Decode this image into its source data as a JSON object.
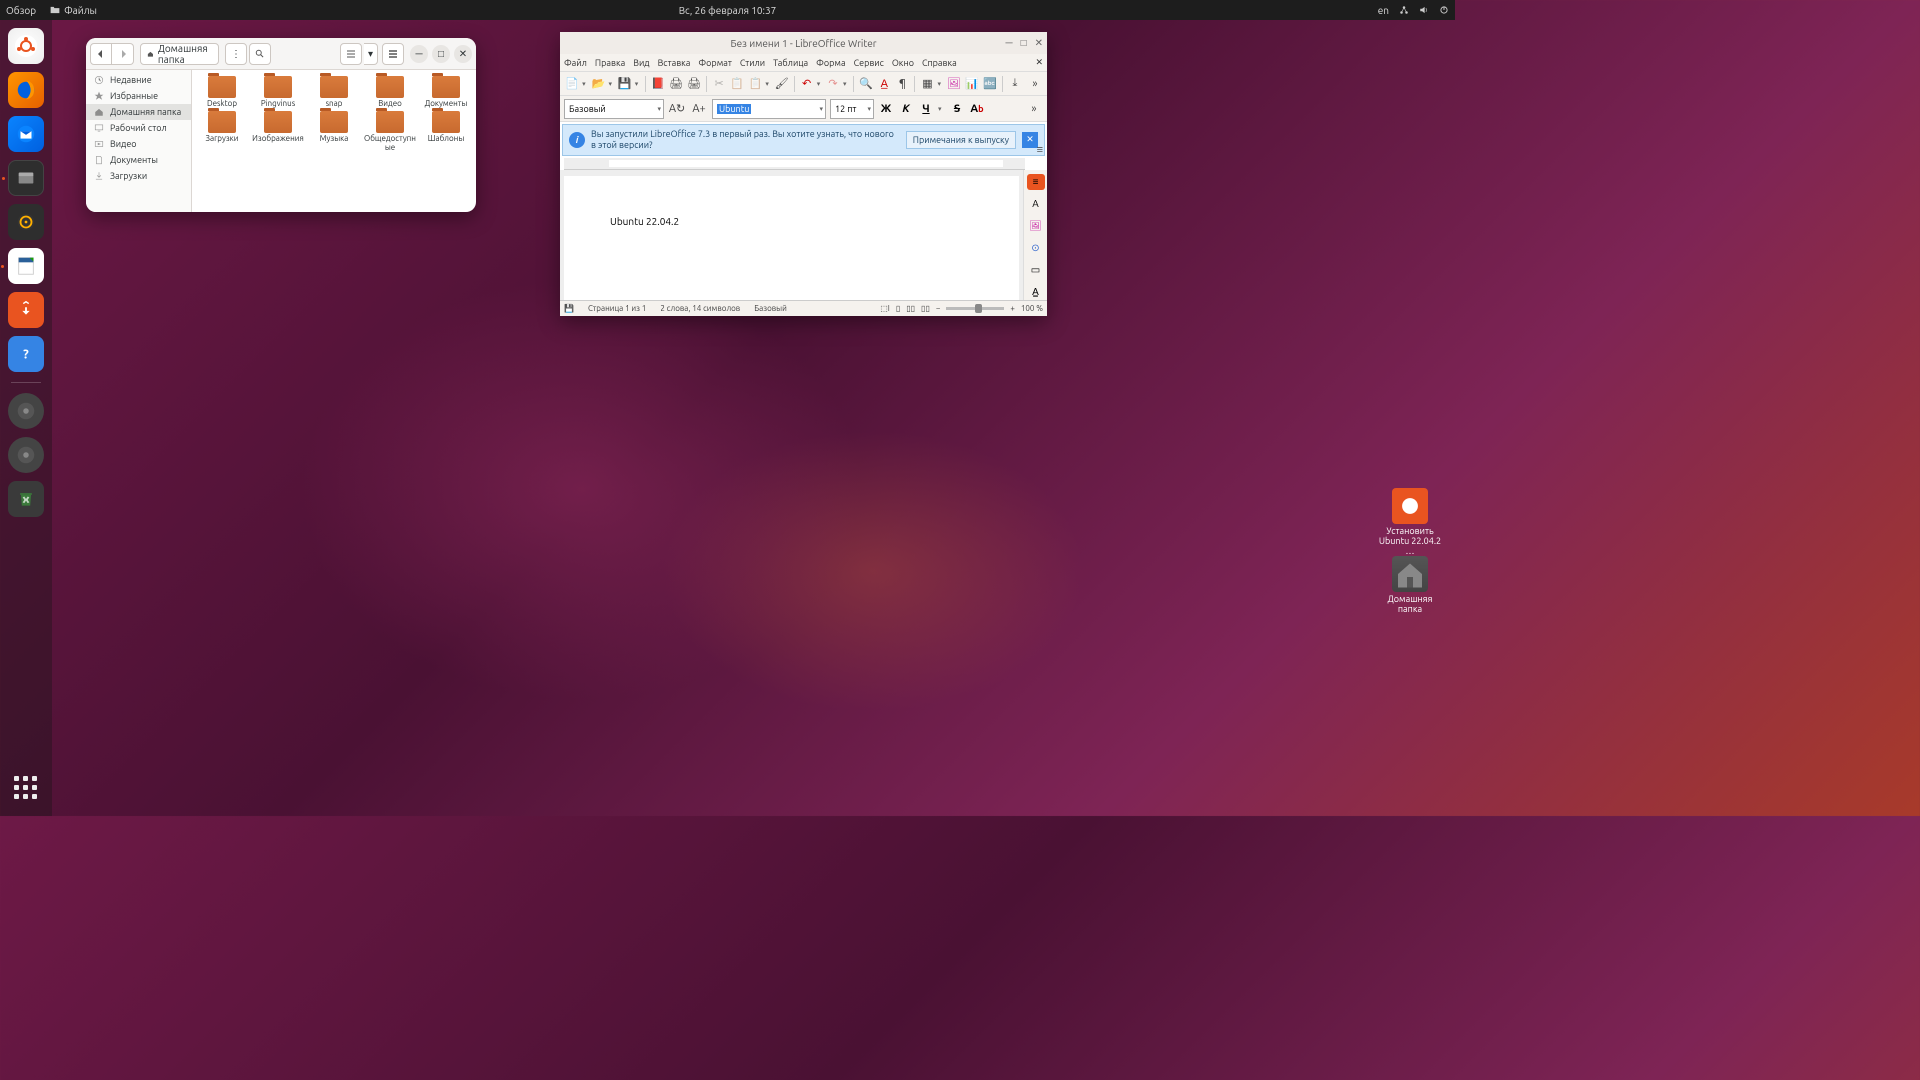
{
  "topbar": {
    "activities": "Обзор",
    "app_menu": "Файлы",
    "datetime": "Вс, 26 февраля  10:37",
    "lang": "en"
  },
  "dock": {
    "items": [
      "ubuntu",
      "firefox",
      "thunderbird",
      "files",
      "rhythmbox",
      "writer",
      "software",
      "help",
      "disk1",
      "disk2",
      "trash"
    ]
  },
  "desktop": {
    "install_label": "Установить Ubuntu 22.04.2 …",
    "home_label": "Домашняя папка"
  },
  "nautilus": {
    "path": "Домашняя папка",
    "sidebar": [
      {
        "icon": "recent",
        "label": "Недавние"
      },
      {
        "icon": "star",
        "label": "Избранные"
      },
      {
        "icon": "home",
        "label": "Домашняя папка",
        "selected": true
      },
      {
        "icon": "desktop",
        "label": "Рабочий стол"
      },
      {
        "icon": "video",
        "label": "Видео"
      },
      {
        "icon": "doc",
        "label": "Документы"
      },
      {
        "icon": "download",
        "label": "Загрузки"
      }
    ],
    "folders": [
      "Desktop",
      "Pingvinus",
      "snap",
      "Видео",
      "Документы",
      "Загрузки",
      "Изображения",
      "Музыка",
      "Общедоступные",
      "Шаблоны"
    ]
  },
  "writer": {
    "title": "Без имени 1 - LibreOffice Writer",
    "menu": [
      "Файл",
      "Правка",
      "Вид",
      "Вставка",
      "Формат",
      "Стили",
      "Таблица",
      "Форма",
      "Сервис",
      "Окно",
      "Справка"
    ],
    "style_combo": "Базовый",
    "font_combo": "Ubuntu",
    "size_combo": "12 пт",
    "format_buttons": {
      "bold": "Ж",
      "italic": "К",
      "underline": "Ч",
      "strike": "S",
      "super": "Aᵇ"
    },
    "infobar_text": "Вы запустили LibreOffice 7.3 в первый раз. Вы хотите узнать, что нового в этой версии?",
    "infobar_btn": "Примечания к выпуску",
    "document_text": "Ubuntu 22.04.2",
    "status": {
      "page": "Страница 1 из 1",
      "words": "2 слова, 14 символов",
      "style": "Базовый",
      "zoom": "100 %"
    }
  }
}
